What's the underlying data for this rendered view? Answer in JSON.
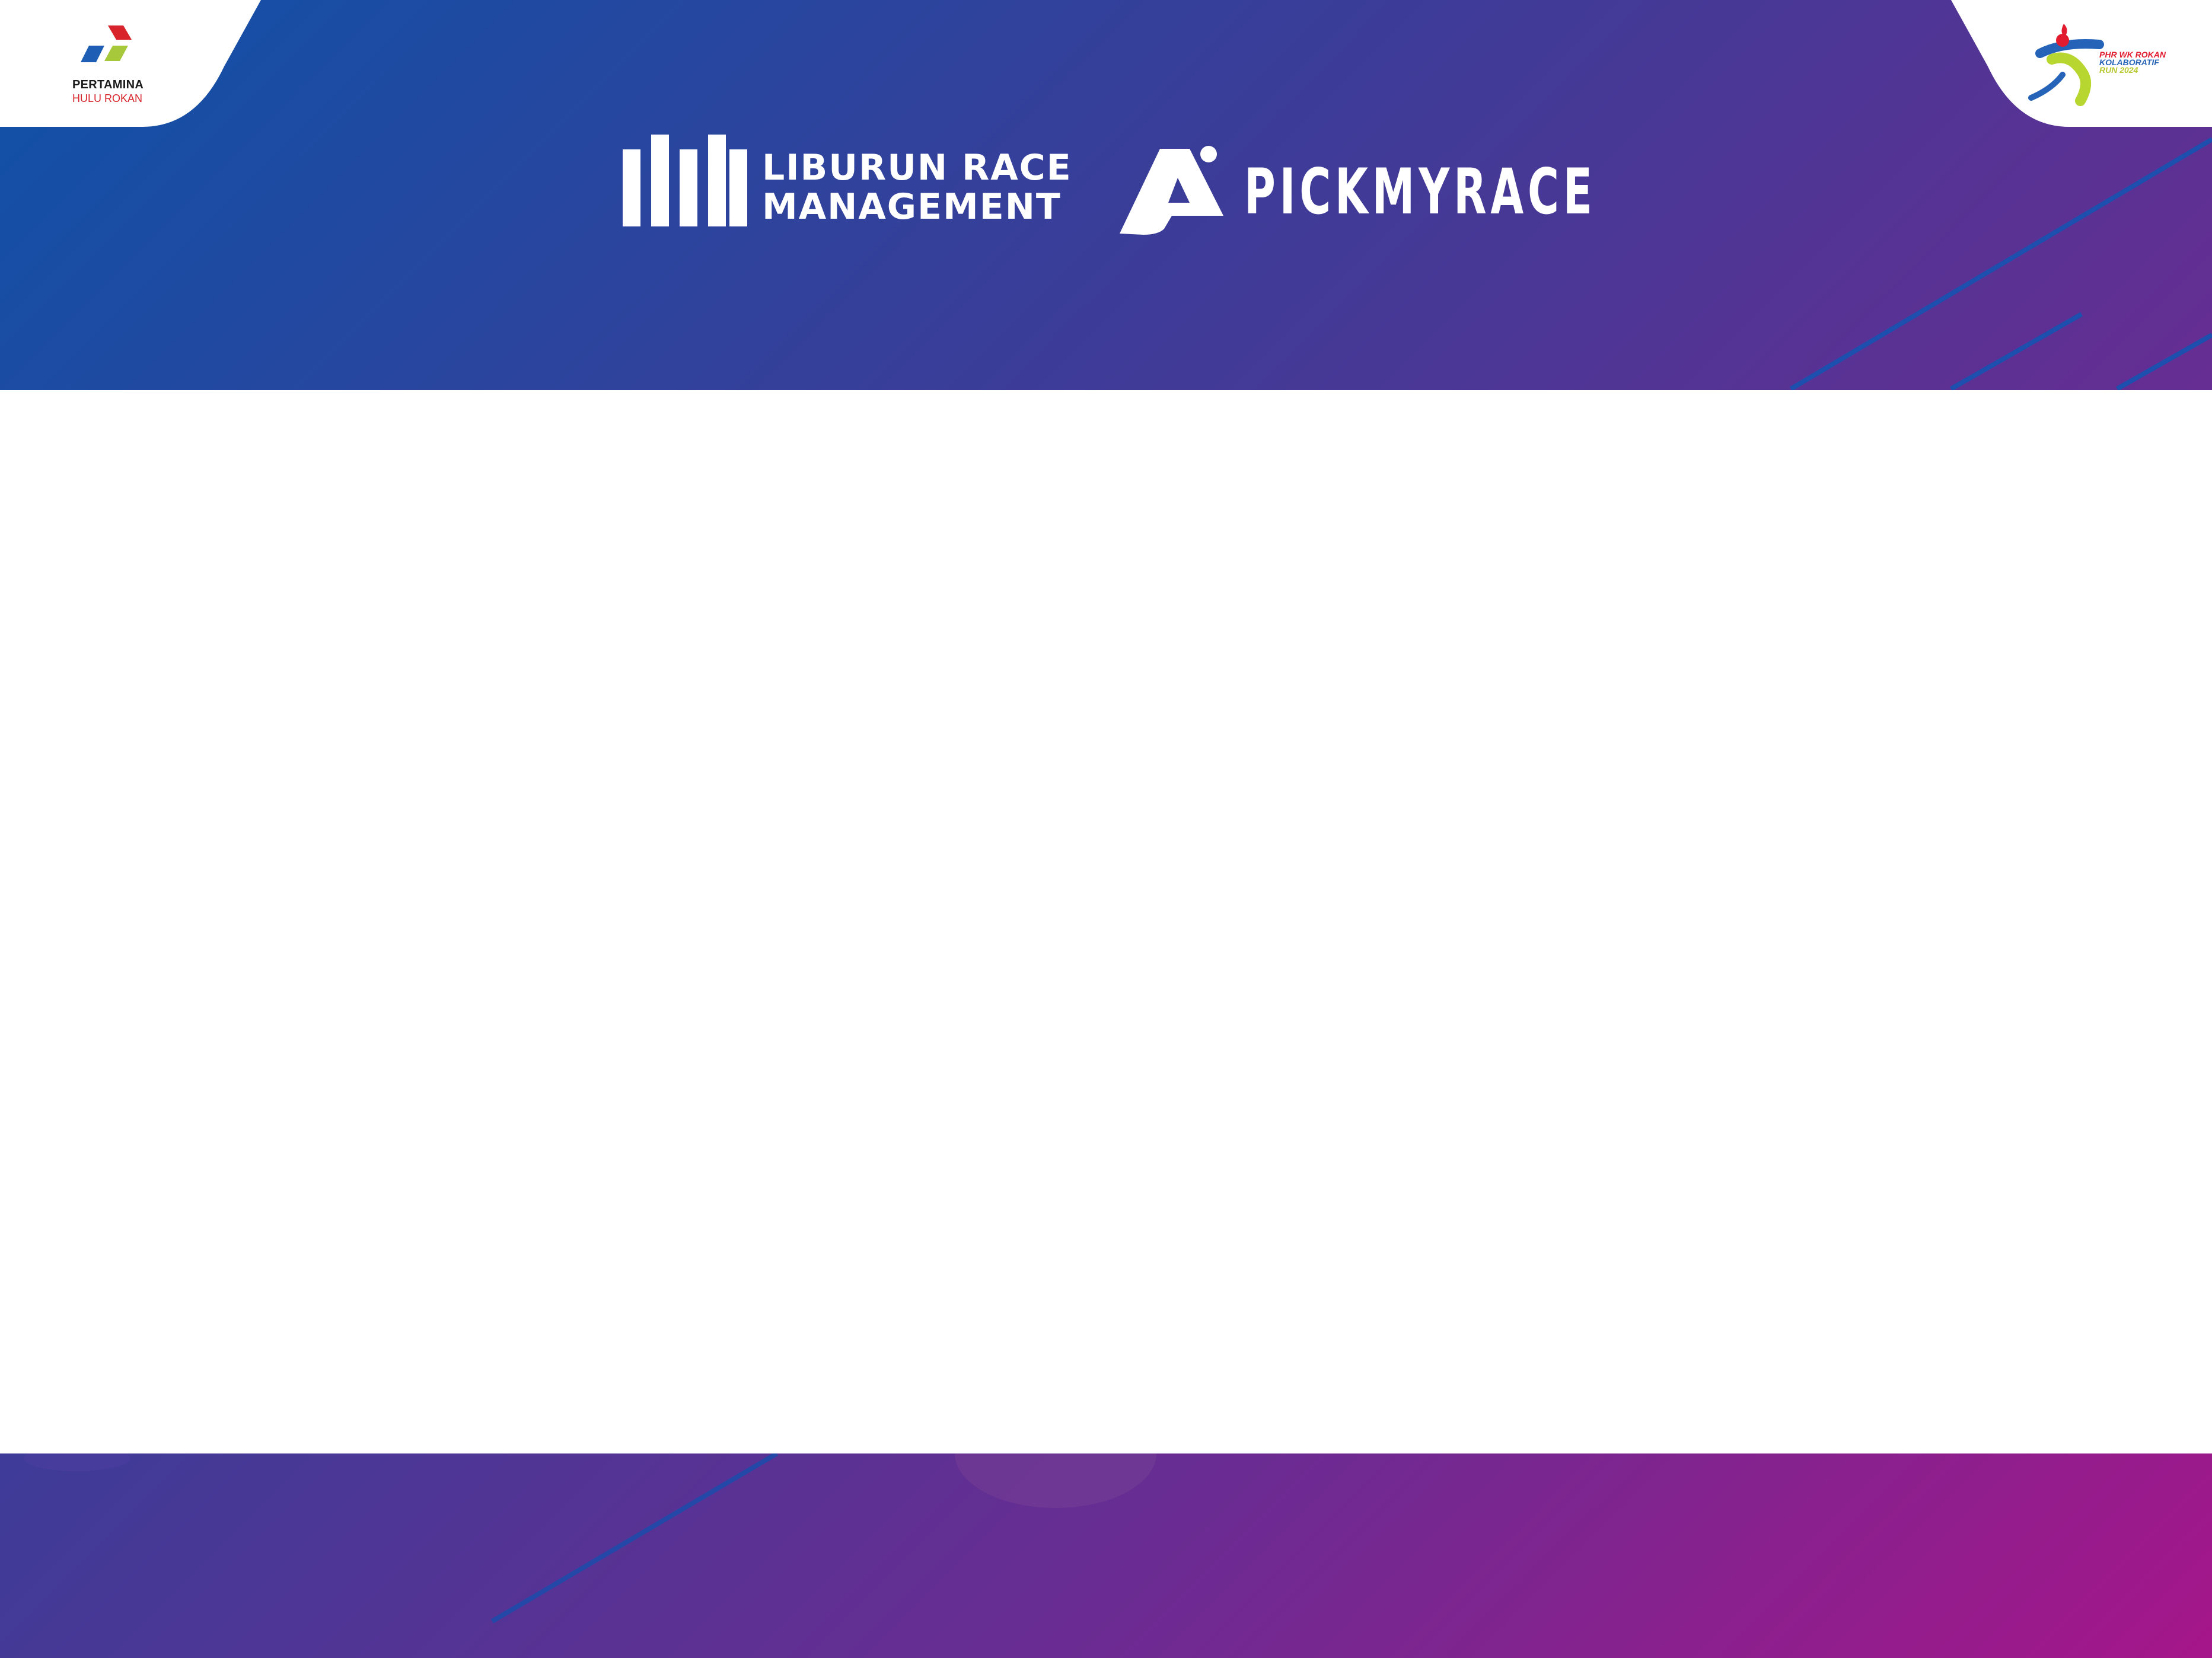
{
  "colors": {
    "gradient_start": "#0f52a8",
    "gradient_mid": "#3a3d98",
    "gradient_end": "#a5168a",
    "panel": "#ffffff",
    "pertamina_red": "#d8232a",
    "pertamina_blue": "#1e5fb5",
    "pertamina_green": "#a6c83a"
  },
  "header": {
    "left_logo": {
      "icon": "pertamina-logo-icon",
      "name": "PERTAMINA",
      "subtitle": "HULU ROKAN"
    },
    "right_logo": {
      "icon": "runner-mascot-icon",
      "line1": "PHR WK ROKAN",
      "line2": "KOLABORATIF",
      "line3": "RUN 2024"
    },
    "sponsors": [
      {
        "icon": "bar-chart-icon",
        "line1": "LIBURUN RACE",
        "line2": "MANAGEMENT"
      },
      {
        "icon": "pickmyrace-mark-icon",
        "name": "PICKMYRACE"
      }
    ]
  },
  "content": {
    "panel": "blank-white-panel"
  }
}
